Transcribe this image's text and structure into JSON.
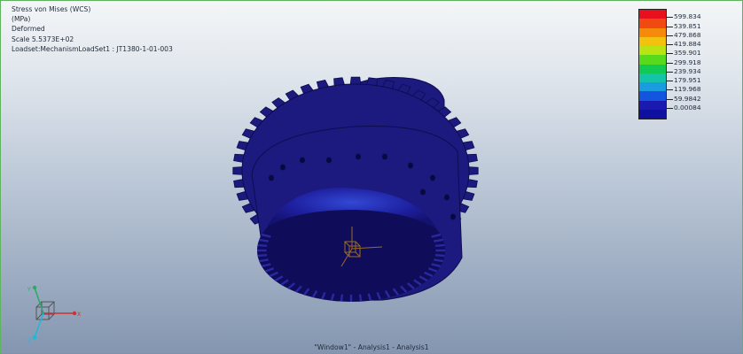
{
  "info": {
    "title": "Stress von Mises (WCS)",
    "units": "(MPa)",
    "mode": "Deformed",
    "scale": "Scale  5.5373E+02",
    "loadset": "Loadset:MechanismLoadSet1  :  JT1380-1-01-003"
  },
  "legend": {
    "values": [
      "599.834",
      "539.851",
      "479.868",
      "419.884",
      "359.901",
      "299.918",
      "239.934",
      "179.951",
      "119.968",
      "59.9842",
      "0.00084"
    ],
    "colors": [
      "#e8101c",
      "#f04a12",
      "#f58a0d",
      "#f3c20e",
      "#b9e313",
      "#59d91b",
      "#12c954",
      "#14c4a8",
      "#1a9de0",
      "#1455e0",
      "#1a1ab0",
      "#1010a0"
    ]
  },
  "triad": {
    "x_label": "X",
    "y_label": "Y",
    "z_label": "Z"
  },
  "status": "\"Window1\" - Analysis1 - Analysis1",
  "colors": {
    "gear_body": "#1c1a7e",
    "gear_dark": "#0e0c4e",
    "gear_light": "#2a28a0",
    "highlight": "#2f47d8"
  }
}
